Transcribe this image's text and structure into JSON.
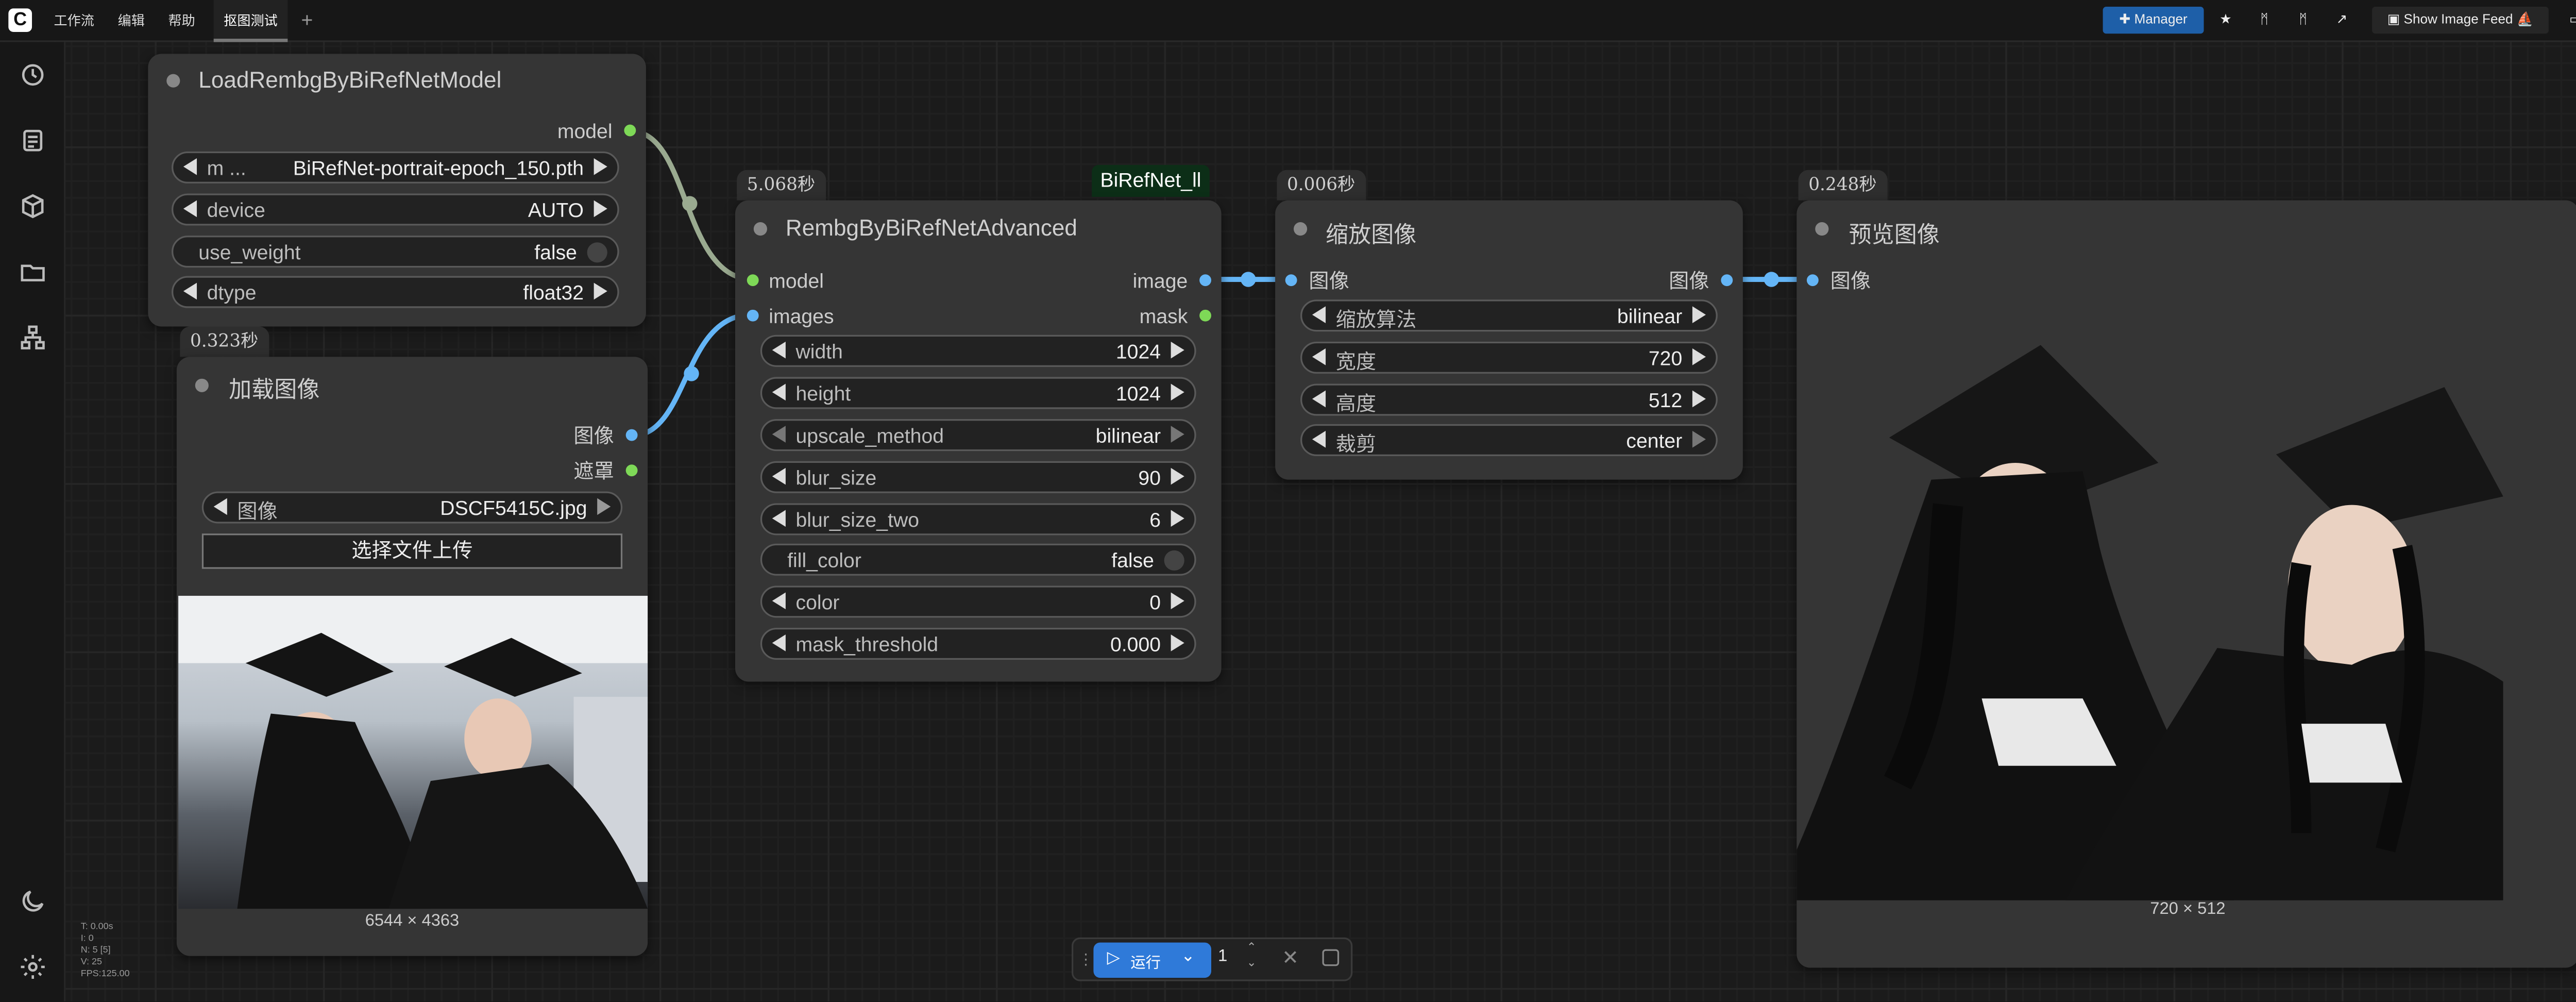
{
  "topbar": {
    "menu": [
      "工作流",
      "编辑",
      "帮助"
    ],
    "active_tab": "抠图测试",
    "manager": "Manager",
    "feed": "Show Image Feed"
  },
  "sidebar": {
    "icons": [
      "history-icon",
      "list-icon",
      "cube-icon",
      "folder-icon",
      "tree-icon"
    ],
    "bottom_icons": [
      "moon-icon",
      "gear-icon"
    ]
  },
  "nodes": {
    "loadmodel": {
      "title": "LoadRembgByBiRefNetModel",
      "out_model": "model",
      "model_label": "m ...",
      "model_value": "BiRefNet-portrait-epoch_150.pth",
      "device_label": "device",
      "device_value": "AUTO",
      "weight_label": "use_weight",
      "weight_value": "false",
      "dtype_label": "dtype",
      "dtype_value": "float32"
    },
    "loadimage": {
      "time": "0.323秒",
      "title": "加载图像",
      "out_image": "图像",
      "out_mask": "遮罩",
      "image_label": "图像",
      "image_value": "DSCF5415C.jpg",
      "upload": "选择文件上传",
      "size": "6544 × 4363"
    },
    "rembg": {
      "time": "5.068秒",
      "badge": "BiRefNet_ll",
      "title": "RembgByBiRefNetAdvanced",
      "in_model": "model",
      "in_images": "images",
      "out_image": "image",
      "out_mask": "mask",
      "widgets": [
        [
          "width",
          "1024"
        ],
        [
          "height",
          "1024"
        ],
        [
          "upscale_method",
          "bilinear"
        ],
        [
          "blur_size",
          "90"
        ],
        [
          "blur_size_two",
          "6"
        ],
        [
          "fill_color",
          "false"
        ],
        [
          "color",
          "0"
        ],
        [
          "mask_threshold",
          "0.000"
        ]
      ]
    },
    "scale": {
      "time": "0.006秒",
      "title": "缩放图像",
      "in_image": "图像",
      "out_image": "图像",
      "widgets": [
        [
          "缩放算法",
          "bilinear"
        ],
        [
          "宽度",
          "720"
        ],
        [
          "高度",
          "512"
        ],
        [
          "裁剪",
          "center"
        ]
      ]
    },
    "preview": {
      "time": "0.248秒",
      "title": "预览图像",
      "in_image": "图像",
      "size": "720 × 512"
    }
  },
  "stats": [
    "T: 0.00s",
    "I: 0",
    "N: 5 [5]",
    "V: 25",
    "FPS:125.00"
  ],
  "runbar": {
    "run": "运行",
    "count": "1"
  },
  "colors": {
    "accent": "#2f7ad9",
    "image_slot": "#64b5f6",
    "model_slot": "#7ed957"
  }
}
